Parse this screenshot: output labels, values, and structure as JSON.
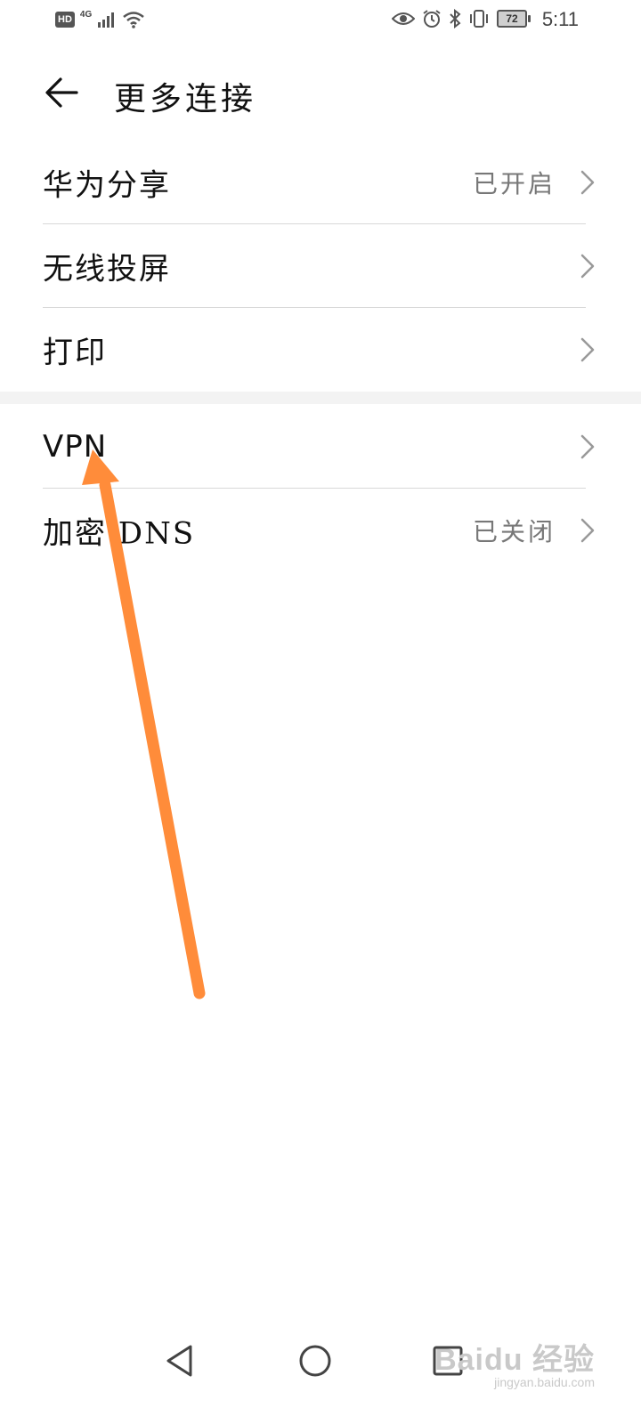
{
  "status_bar": {
    "hd_badge": "HD",
    "network": "4G",
    "battery": "72",
    "time": "5:11",
    "icons": [
      "signal-icon",
      "wifi-icon",
      "eye-icon",
      "alarm-icon",
      "bluetooth-icon",
      "vibrate-icon",
      "battery-icon"
    ]
  },
  "header": {
    "title": "更多连接",
    "back_icon": "back-arrow-icon"
  },
  "settings": {
    "group1": [
      {
        "label": "华为分享",
        "value": "已开启"
      },
      {
        "label": "无线投屏",
        "value": ""
      },
      {
        "label": "打印",
        "value": ""
      }
    ],
    "group2": [
      {
        "label": "VPN",
        "value": ""
      },
      {
        "label": "加密 DNS",
        "value": "已关闭"
      }
    ]
  },
  "annotation": {
    "type": "arrow",
    "color": "#ff8c3a",
    "points_to": "VPN"
  },
  "nav_bar": {
    "buttons": [
      "back-triangle-icon",
      "home-circle-icon",
      "recents-square-icon"
    ]
  },
  "watermark": {
    "main": "Baidu 经验",
    "sub": "jingyan.baidu.com"
  }
}
